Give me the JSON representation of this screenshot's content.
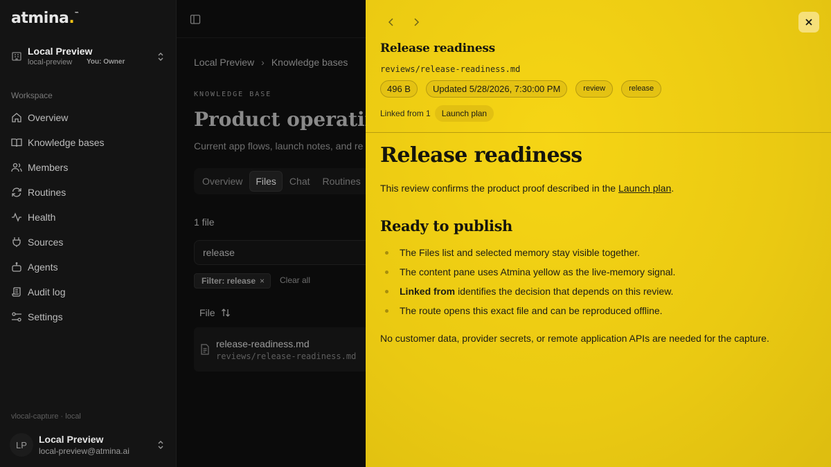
{
  "brand": {
    "logo": "atmina",
    "tm": "™"
  },
  "org": {
    "name": "Local Preview",
    "slug": "local-preview",
    "role": "You: Owner"
  },
  "sidebar": {
    "section": "Workspace",
    "items": [
      {
        "label": "Overview",
        "icon": "home-icon"
      },
      {
        "label": "Knowledge bases",
        "icon": "book-icon"
      },
      {
        "label": "Members",
        "icon": "users-icon"
      },
      {
        "label": "Routines",
        "icon": "refresh-icon"
      },
      {
        "label": "Health",
        "icon": "activity-icon"
      },
      {
        "label": "Sources",
        "icon": "plug-icon"
      },
      {
        "label": "Agents",
        "icon": "bot-icon"
      },
      {
        "label": "Audit log",
        "icon": "scroll-icon"
      },
      {
        "label": "Settings",
        "icon": "sliders-icon"
      }
    ],
    "version": "vlocal-capture · local"
  },
  "user": {
    "initials": "LP",
    "name": "Local Preview",
    "email": "local-preview@atmina.ai"
  },
  "main": {
    "breadcrumb": [
      "Local Preview",
      "Knowledge bases"
    ],
    "kicker": "KNOWLEDGE BASE",
    "title": "Product operating",
    "subtitle": "Current app flows, launch notes, and re",
    "tabs": [
      {
        "label": "Overview",
        "active": false
      },
      {
        "label": "Files",
        "active": true
      },
      {
        "label": "Chat",
        "active": false
      },
      {
        "label": "Routines",
        "active": false
      }
    ],
    "file_count": "1 file",
    "search_value": "release",
    "filter_chip": "Filter: release",
    "filter_remove": "×",
    "clear_all": "Clear all",
    "file_column": "File",
    "file": {
      "name": "release-readiness.md",
      "path": "reviews/release-readiness.md"
    }
  },
  "drawer": {
    "title": "Release readiness",
    "path": "reviews/release-readiness.md",
    "size": "496 B",
    "updated": "Updated 5/28/2026, 7:30:00 PM",
    "tags": [
      "review",
      "release"
    ],
    "linked_label": "Linked from 1",
    "linked_doc": "Launch plan",
    "doc": {
      "h1": "Release readiness",
      "p1_before": "This review confirms the product proof described in the ",
      "p1_link": "Launch plan",
      "p1_after": ".",
      "h2": "Ready to publish",
      "bullets": [
        {
          "bold": "",
          "text": "The Files list and selected memory stay visible together."
        },
        {
          "bold": "",
          "text": "The content pane uses Atmina yellow as the live-memory signal."
        },
        {
          "bold": "Linked from",
          "text": "identifies the decision that depends on this review."
        },
        {
          "bold": "",
          "text": "The route opens this exact file and can be reproduced offline."
        }
      ],
      "p2": "No customer data, provider secrets, or remote application APIs are needed for the capture."
    }
  },
  "colors": {
    "accent": "#f0cd14",
    "background": "#0a0a0a",
    "sidebar": "#141414"
  }
}
